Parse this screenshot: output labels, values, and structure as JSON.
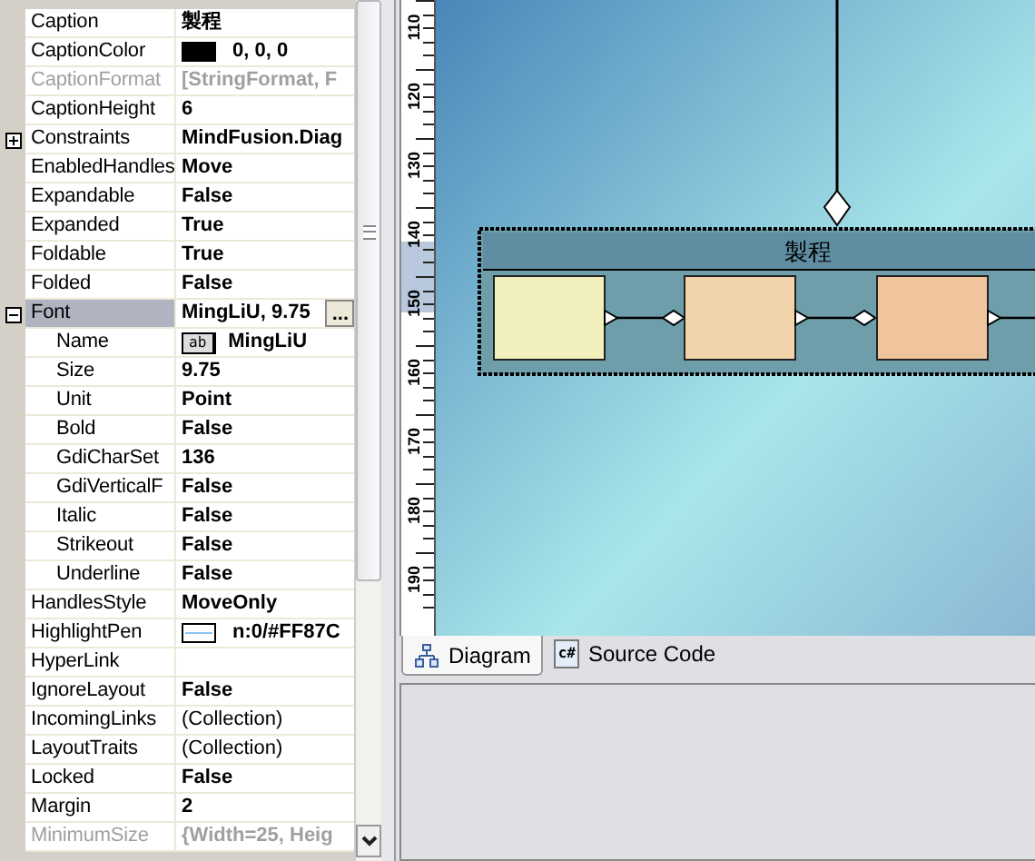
{
  "property_grid": {
    "rows": [
      {
        "name": "Caption",
        "value": "製程",
        "modified": true,
        "disabled": false,
        "selected": false
      },
      {
        "name": "CaptionColor",
        "value": "0, 0, 0",
        "kind": "color",
        "modified": true,
        "disabled": false,
        "selected": false
      },
      {
        "name": "CaptionFormat",
        "value": "[StringFormat, F",
        "modified": true,
        "disabled": true,
        "selected": false
      },
      {
        "name": "CaptionHeight",
        "value": "6",
        "modified": true,
        "disabled": false,
        "selected": false
      },
      {
        "name": "Constraints",
        "value": "MindFusion.Diag",
        "modified": true,
        "disabled": false,
        "selected": false,
        "expanded": false
      },
      {
        "name": "EnabledHandles",
        "value": "Move",
        "modified": true,
        "disabled": false,
        "selected": false
      },
      {
        "name": "Expandable",
        "value": "False",
        "modified": true,
        "disabled": false,
        "selected": false
      },
      {
        "name": "Expanded",
        "value": "True",
        "modified": true,
        "disabled": false,
        "selected": false
      },
      {
        "name": "Foldable",
        "value": "True",
        "modified": true,
        "disabled": false,
        "selected": false
      },
      {
        "name": "Folded",
        "value": "False",
        "modified": true,
        "disabled": false,
        "selected": false
      },
      {
        "name": "Font",
        "value": "MingLiU, 9.75",
        "button": "...",
        "modified": true,
        "disabled": false,
        "selected": true,
        "expanded": true,
        "children": [
          {
            "name": "Name",
            "value": "MingLiU",
            "kind": "font",
            "preview": "ab",
            "modified": true,
            "disabled": false,
            "selected": false
          },
          {
            "name": "Size",
            "value": "9.75",
            "modified": true,
            "disabled": false,
            "selected": false
          },
          {
            "name": "Unit",
            "value": "Point",
            "modified": true,
            "disabled": false,
            "selected": false
          },
          {
            "name": "Bold",
            "value": "False",
            "modified": true,
            "disabled": false,
            "selected": false
          },
          {
            "name": "GdiCharSet",
            "value": "136",
            "modified": true,
            "disabled": false,
            "selected": false
          },
          {
            "name": "GdiVerticalF",
            "value": "False",
            "modified": true,
            "disabled": false,
            "selected": false
          },
          {
            "name": "Italic",
            "value": "False",
            "modified": true,
            "disabled": false,
            "selected": false
          },
          {
            "name": "Strikeout",
            "value": "False",
            "modified": true,
            "disabled": false,
            "selected": false
          },
          {
            "name": "Underline",
            "value": "False",
            "modified": true,
            "disabled": false,
            "selected": false
          }
        ]
      },
      {
        "name": "HandlesStyle",
        "value": "MoveOnly",
        "modified": true,
        "disabled": false,
        "selected": false
      },
      {
        "name": "HighlightPen",
        "value": "n:0/#FF87C",
        "kind": "pen",
        "modified": true,
        "disabled": false,
        "selected": false
      },
      {
        "name": "HyperLink",
        "disabled": false,
        "selected": false
      },
      {
        "name": "IgnoreLayout",
        "value": "False",
        "modified": true,
        "disabled": false,
        "selected": false
      },
      {
        "name": "IncomingLinks",
        "value": "(Collection)",
        "modified": false,
        "disabled": false,
        "selected": false
      },
      {
        "name": "LayoutTraits",
        "value": "(Collection)",
        "modified": false,
        "disabled": false,
        "selected": false
      },
      {
        "name": "Locked",
        "value": "False",
        "modified": true,
        "disabled": false,
        "selected": false
      },
      {
        "name": "Margin",
        "value": "2",
        "modified": true,
        "disabled": false,
        "selected": false
      },
      {
        "name": "MinimumSize",
        "value": "{Width=25, Heig",
        "modified": true,
        "disabled": true,
        "selected": false
      }
    ]
  },
  "diagram": {
    "ruler_labels": [
      "110",
      "120",
      "130",
      "140",
      "150",
      "160",
      "170",
      "180",
      "190"
    ],
    "container": {
      "caption": "製程"
    },
    "nodes": [
      {
        "color": "#f1f0bc"
      },
      {
        "color": "#f1d4aa"
      },
      {
        "color": "#f0c49c"
      }
    ]
  },
  "tabs": [
    {
      "label": "Diagram",
      "selected": true
    },
    {
      "label": "Source Code",
      "icon_text": "c#",
      "selected": false
    }
  ]
}
